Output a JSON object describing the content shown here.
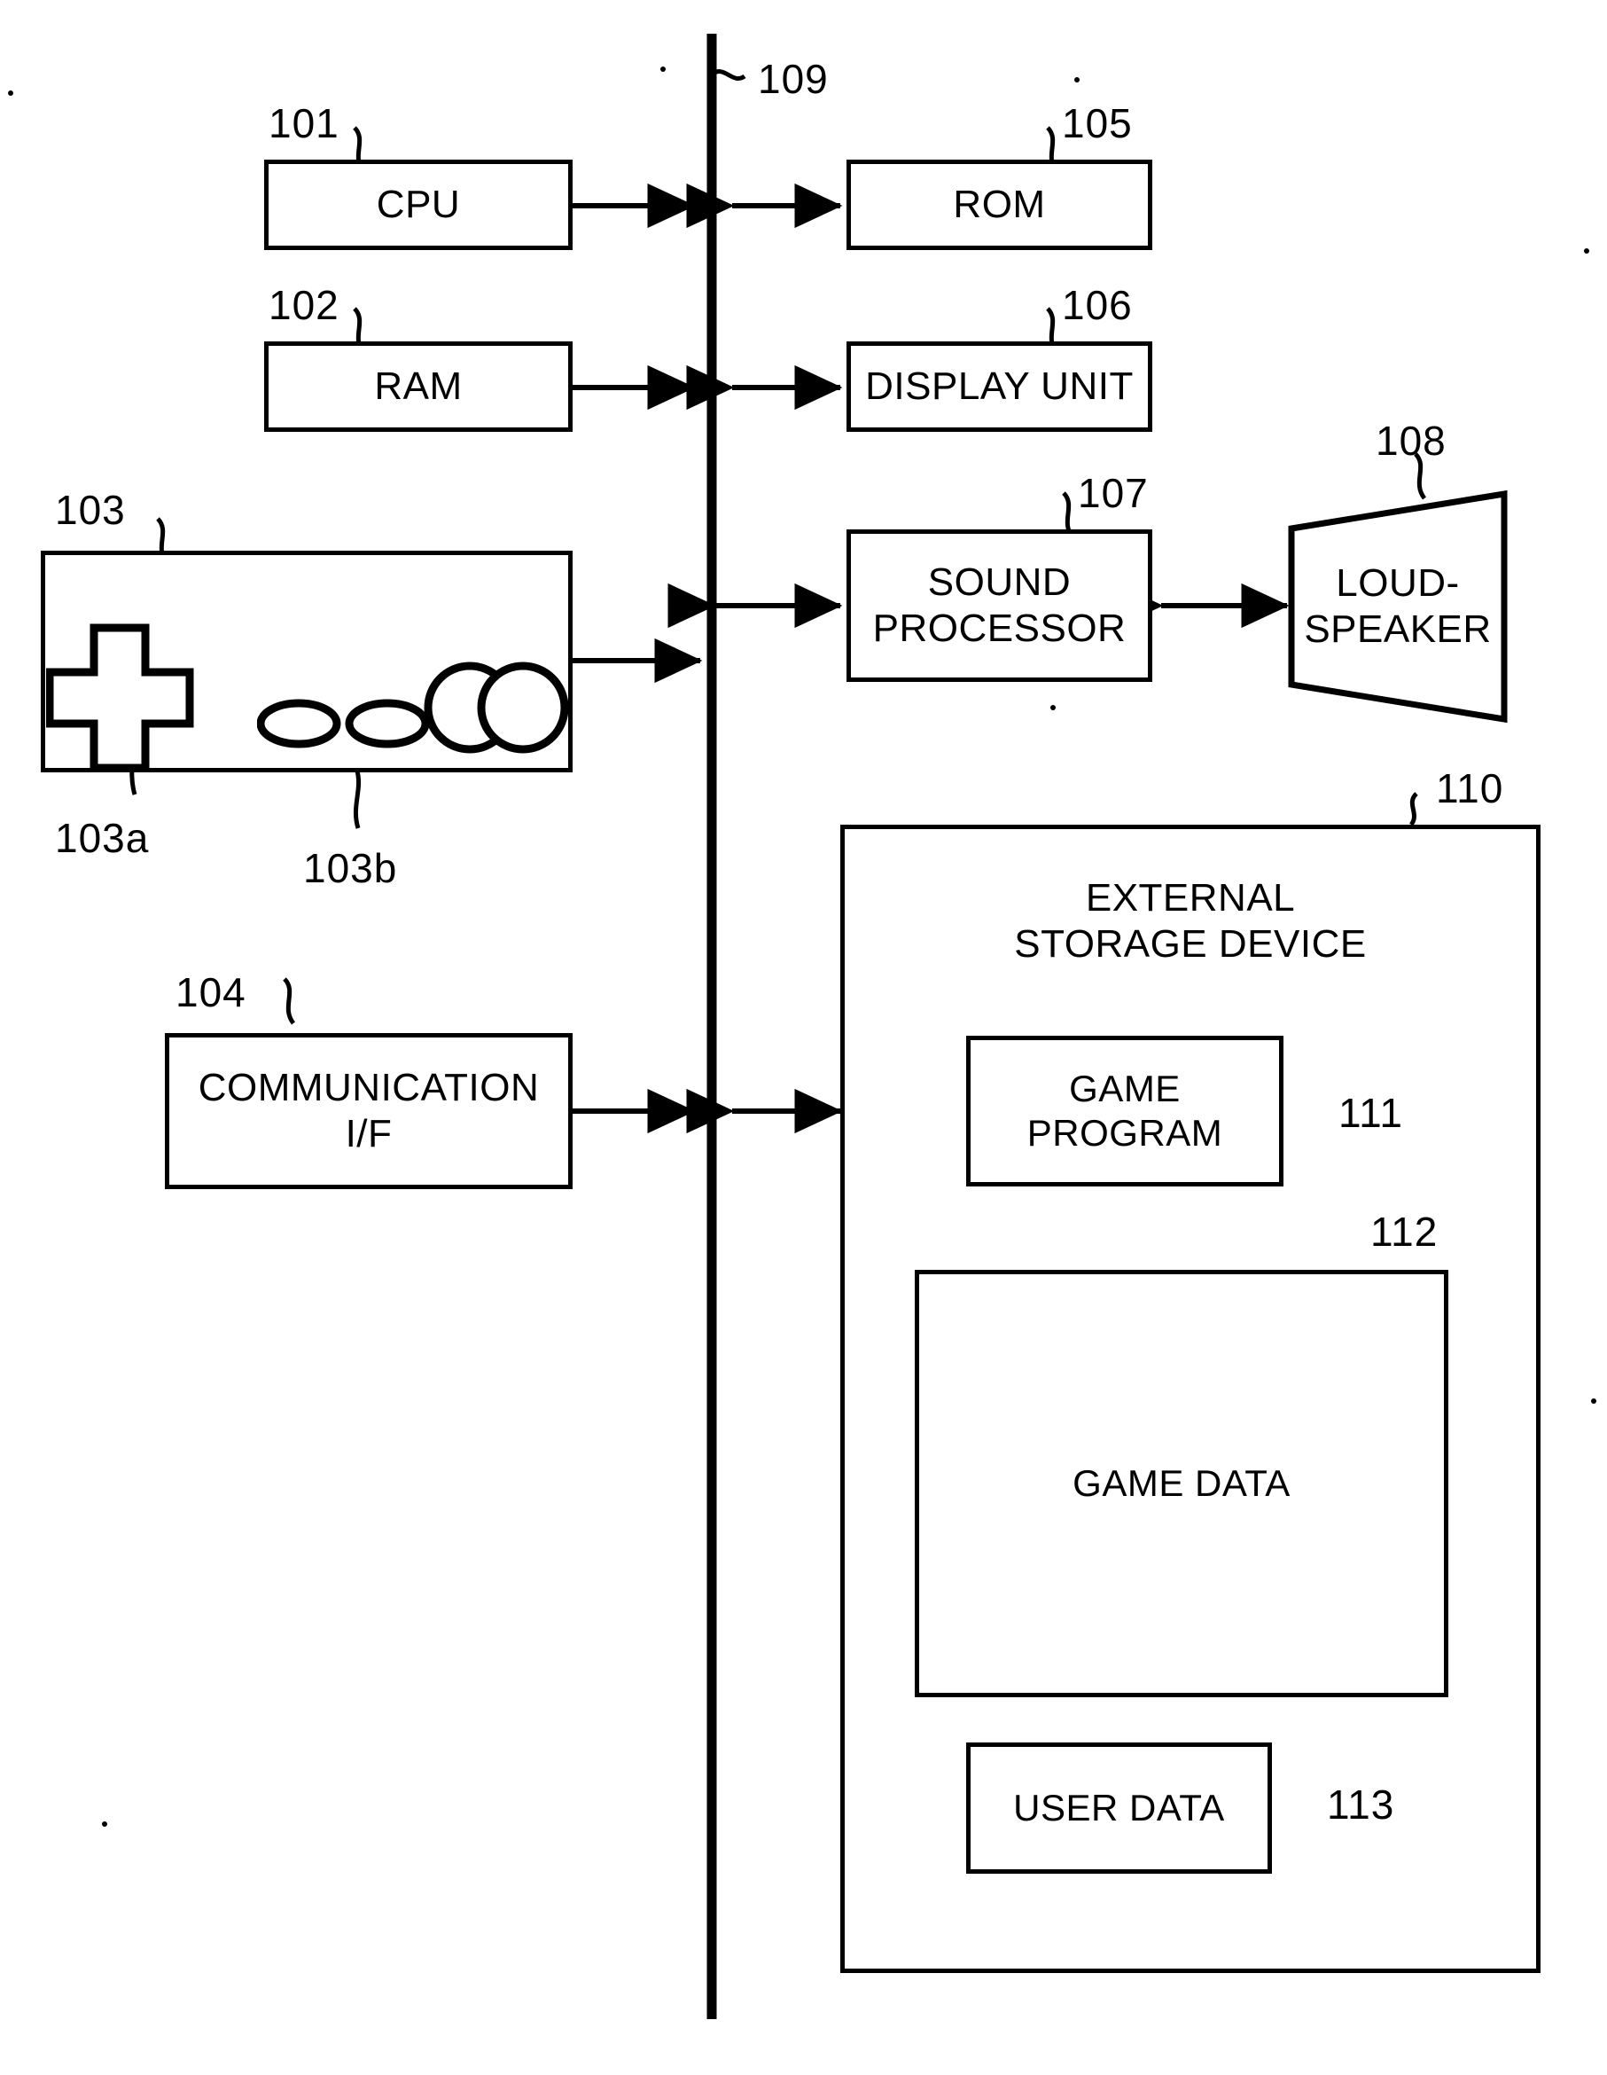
{
  "figure": {
    "type": "patent-block-diagram",
    "background": "#ffffff",
    "line_color": "#000000"
  },
  "blocks": {
    "cpu": {
      "label": "CPU",
      "ref": "101"
    },
    "ram": {
      "label": "RAM",
      "ref": "102"
    },
    "controller": {
      "label": "",
      "ref": "103"
    },
    "dpad": {
      "label": "",
      "ref": "103a"
    },
    "buttons": {
      "label": "",
      "ref": "103b"
    },
    "comm_if": {
      "label": "COMMUNICATION\nI/F",
      "ref": "104"
    },
    "rom": {
      "label": "ROM",
      "ref": "105"
    },
    "display": {
      "label": "DISPLAY UNIT",
      "ref": "106"
    },
    "sound": {
      "label": "SOUND\nPROCESSOR",
      "ref": "107"
    },
    "speaker": {
      "label": "LOUD-\nSPEAKER",
      "ref": "108"
    },
    "bus": {
      "label": "",
      "ref": "109"
    },
    "storage": {
      "label": "EXTERNAL\nSTORAGE DEVICE",
      "ref": "110"
    },
    "game_program": {
      "label": "GAME\nPROGRAM",
      "ref": "111"
    },
    "game_data": {
      "label": "GAME DATA",
      "ref": "112"
    },
    "user_data": {
      "label": "USER DATA",
      "ref": "113"
    }
  }
}
